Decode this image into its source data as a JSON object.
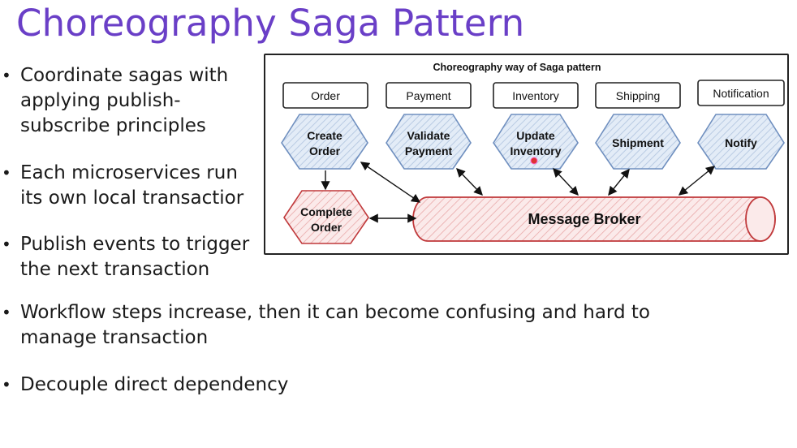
{
  "slide": {
    "title": "Choreography Saga Pattern"
  },
  "bullets": [
    {
      "lines": "Coordinate sagas with\napplying publish-\nsubscribe principles"
    },
    {
      "lines": "Each microservices run\nits own local transactior"
    },
    {
      "lines": "Publish events to trigger\nthe next transaction"
    },
    {
      "lines": "Workflow steps increase, then it can become confusing and hard to\nmanage transaction"
    },
    {
      "lines": "Decouple direct dependency"
    }
  ],
  "diagram": {
    "title": "Choreography way of Saga pattern",
    "services": [
      {
        "label": "Order",
        "step_line1": "Create",
        "step_line2": "Order"
      },
      {
        "label": "Payment",
        "step_line1": "Validate",
        "step_line2": "Payment"
      },
      {
        "label": "Inventory",
        "step_line1": "Update",
        "step_line2": "Inventory"
      },
      {
        "label": "Shipping",
        "step_line1": "Shipment",
        "step_line2": ""
      },
      {
        "label": "Notification",
        "step_line1": "Notify",
        "step_line2": ""
      }
    ],
    "complete": {
      "line1": "Complete",
      "line2": "Order"
    },
    "broker": "Message Broker",
    "colors": {
      "hex_fill": "#dbe6f4",
      "hex_stroke": "#6f8fbf",
      "broker_stroke": "#c0393b",
      "broker_hatch": "#e7a3a3",
      "title_purple": "#6a3fc7"
    }
  }
}
